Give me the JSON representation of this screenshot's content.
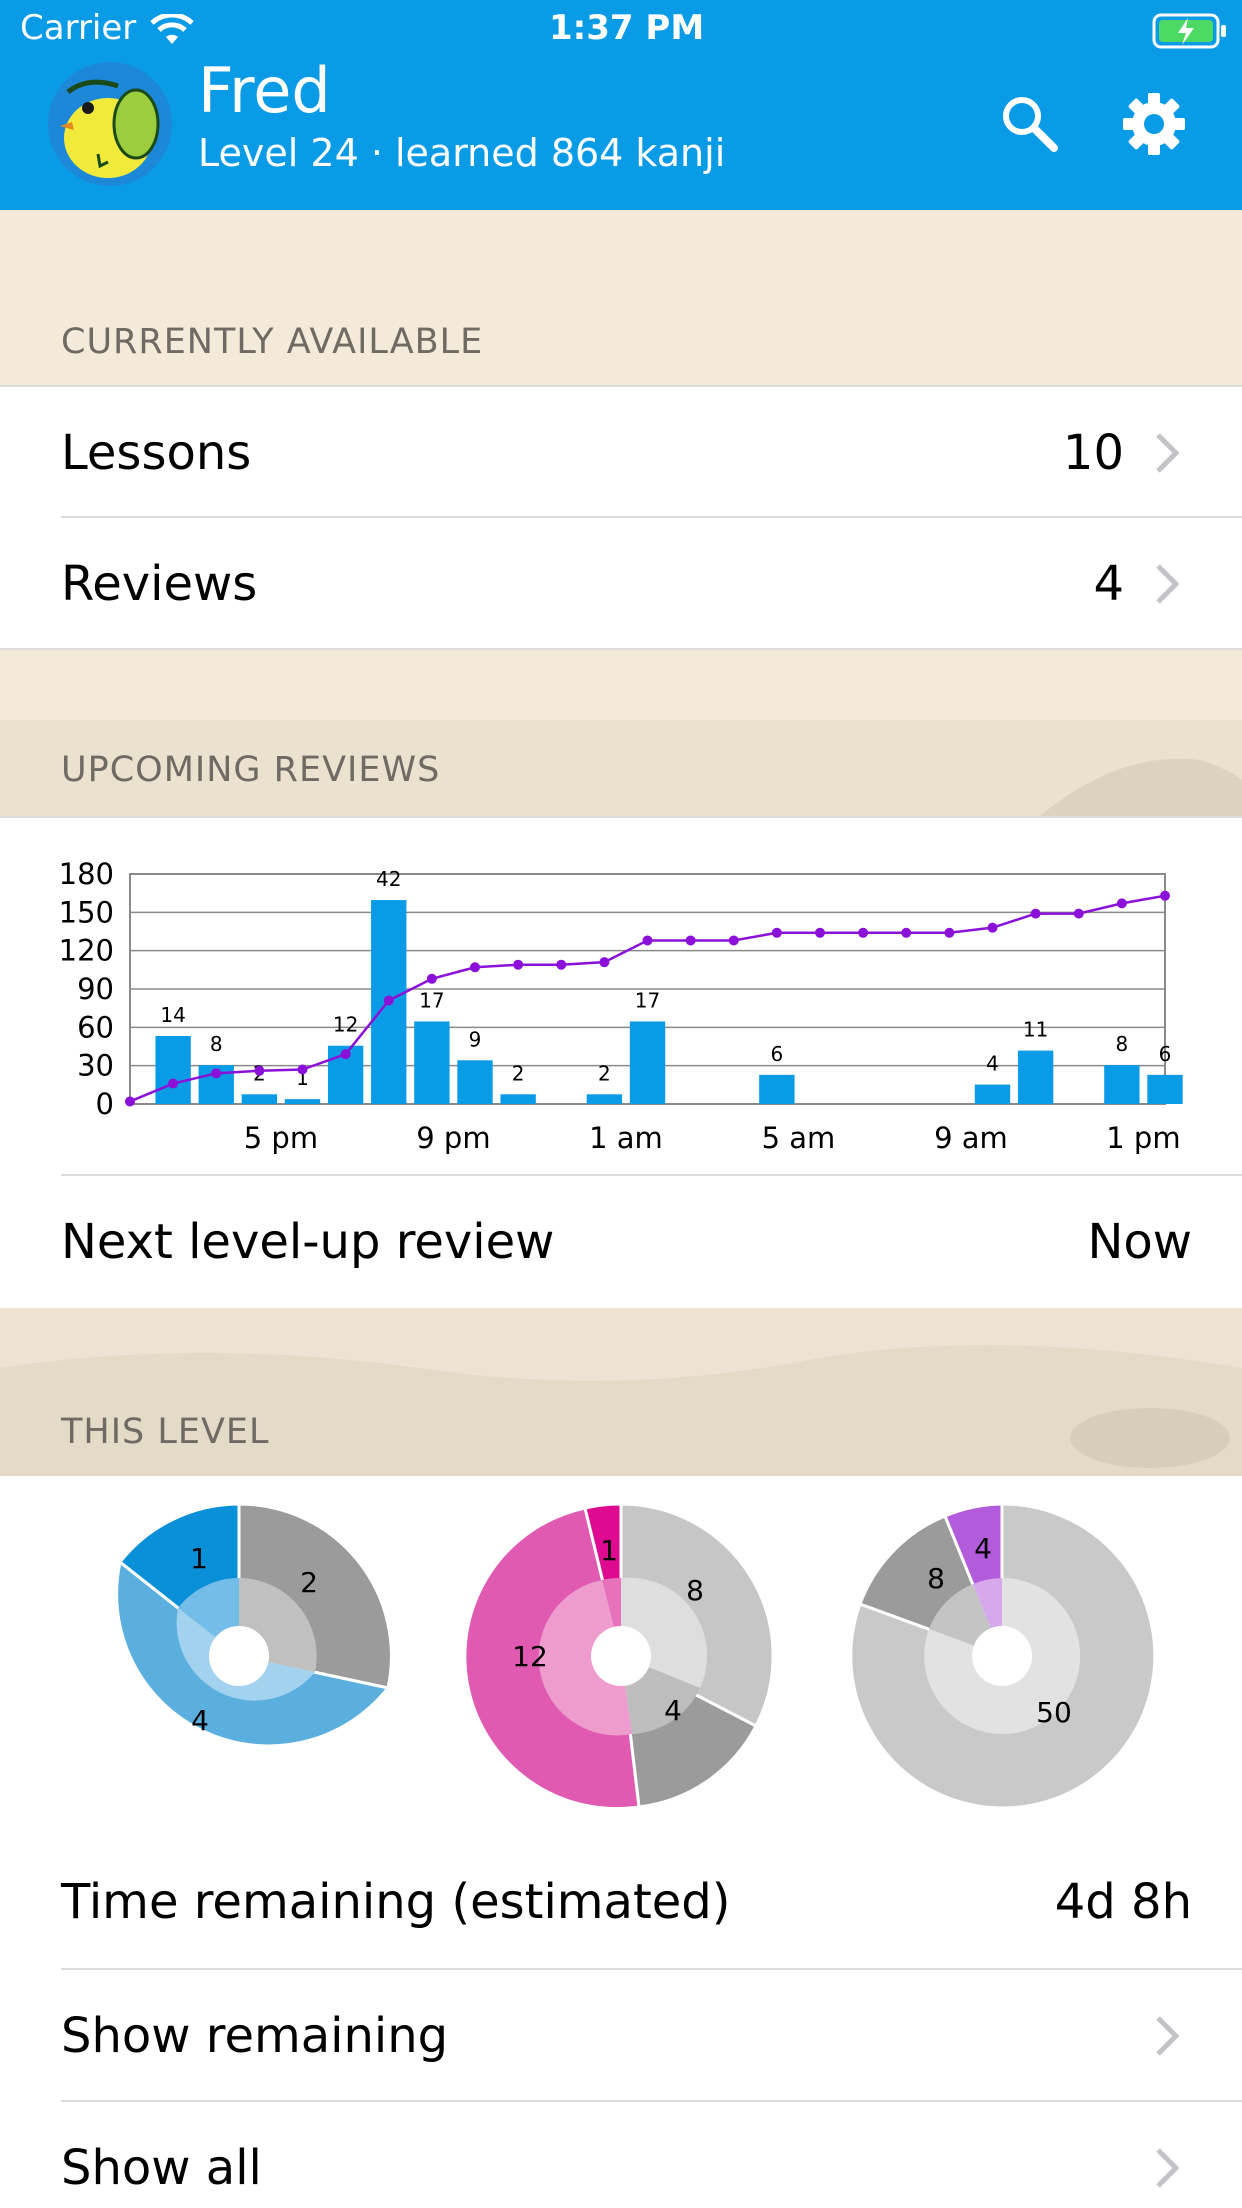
{
  "status_bar": {
    "carrier": "Carrier",
    "time": "1:37 PM"
  },
  "header": {
    "user_name": "Fred",
    "user_subtitle": "Level 24 · learned 864 kanji",
    "icons": [
      "search-icon",
      "gear-icon"
    ],
    "color": "#0a9be6"
  },
  "sections": {
    "currently_available": "CURRENTLY AVAILABLE",
    "upcoming_reviews": "UPCOMING REVIEWS",
    "this_level": "THIS LEVEL"
  },
  "available": {
    "lessons_label": "Lessons",
    "lessons_count": "10",
    "reviews_label": "Reviews",
    "reviews_count": "4"
  },
  "next_levelup": {
    "label": "Next level-up review",
    "value": "Now"
  },
  "chart_data": {
    "type": "bar",
    "yticks": [
      "180",
      "150",
      "120",
      "90",
      "60",
      "30",
      "0"
    ],
    "ylim": [
      0,
      180
    ],
    "xticks": [
      {
        "label": "5 pm",
        "slot": 4
      },
      {
        "label": "9 pm",
        "slot": 8
      },
      {
        "label": "1 am",
        "slot": 12
      },
      {
        "label": "5 am",
        "slot": 16
      },
      {
        "label": "9 am",
        "slot": 20
      },
      {
        "label": "1 pm",
        "slot": 24
      }
    ],
    "bars": [
      {
        "slot": 1,
        "value": 14,
        "label": "14"
      },
      {
        "slot": 2,
        "value": 8,
        "label": "8"
      },
      {
        "slot": 3,
        "value": 2,
        "label": "2"
      },
      {
        "slot": 4,
        "value": 1,
        "label": "1"
      },
      {
        "slot": 5,
        "value": 12,
        "label": "12"
      },
      {
        "slot": 6,
        "value": 42,
        "label": "42"
      },
      {
        "slot": 7,
        "value": 17,
        "label": "17"
      },
      {
        "slot": 8,
        "value": 9,
        "label": "9"
      },
      {
        "slot": 9,
        "value": 2,
        "label": "2"
      },
      {
        "slot": 11,
        "value": 2,
        "label": "2"
      },
      {
        "slot": 12,
        "value": 17,
        "label": "17"
      },
      {
        "slot": 15,
        "value": 6,
        "label": "6"
      },
      {
        "slot": 20,
        "value": 4,
        "label": "4"
      },
      {
        "slot": 21,
        "value": 11,
        "label": "11"
      },
      {
        "slot": 23,
        "value": 8,
        "label": "8"
      },
      {
        "slot": 24,
        "value": 6,
        "label": "6"
      }
    ],
    "cumulative_line": [
      {
        "slot": 0,
        "value": 2
      },
      {
        "slot": 1,
        "value": 16
      },
      {
        "slot": 2,
        "value": 24
      },
      {
        "slot": 3,
        "value": 26
      },
      {
        "slot": 4,
        "value": 27
      },
      {
        "slot": 5,
        "value": 39
      },
      {
        "slot": 6,
        "value": 81
      },
      {
        "slot": 7,
        "value": 98
      },
      {
        "slot": 8,
        "value": 107
      },
      {
        "slot": 9,
        "value": 109
      },
      {
        "slot": 10,
        "value": 109
      },
      {
        "slot": 11,
        "value": 111
      },
      {
        "slot": 12,
        "value": 128
      },
      {
        "slot": 13,
        "value": 128
      },
      {
        "slot": 14,
        "value": 128
      },
      {
        "slot": 15,
        "value": 134
      },
      {
        "slot": 16,
        "value": 134
      },
      {
        "slot": 17,
        "value": 134
      },
      {
        "slot": 18,
        "value": 134
      },
      {
        "slot": 19,
        "value": 134
      },
      {
        "slot": 20,
        "value": 138
      },
      {
        "slot": 21,
        "value": 149
      },
      {
        "slot": 22,
        "value": 149
      },
      {
        "slot": 23,
        "value": 157
      },
      {
        "slot": 24,
        "value": 163
      }
    ],
    "bar_color": "#0a9be6",
    "line_color": "#8b10d8"
  },
  "level_pies": [
    {
      "labels": [
        "1",
        "2",
        "4"
      ]
    },
    {
      "labels": [
        "1",
        "8",
        "12",
        "4"
      ]
    },
    {
      "labels": [
        "4",
        "8",
        "50"
      ]
    }
  ],
  "level_rows": {
    "time_remaining_label": "Time remaining (estimated)",
    "time_remaining_value": "4d 8h",
    "show_remaining_label": "Show remaining",
    "show_all_label": "Show all"
  }
}
